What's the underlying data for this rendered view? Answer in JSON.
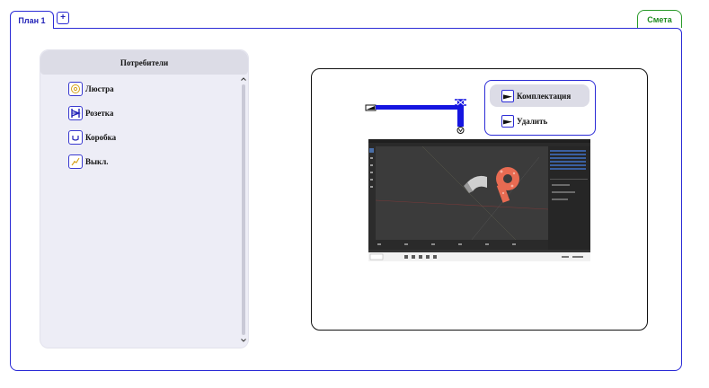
{
  "tabs": {
    "plan_label": "План 1",
    "add_label": "+",
    "estimate_label": "Смета"
  },
  "consumers": {
    "title": "Потребители",
    "items": [
      {
        "label": "Люстра",
        "icon": "chandelier-icon",
        "icon_color": "#d4a017"
      },
      {
        "label": "Розетка",
        "icon": "socket-icon",
        "icon_color": "#2323b8"
      },
      {
        "label": "Коробка",
        "icon": "junction-box-icon",
        "icon_color": "#2323b8"
      },
      {
        "label": "Выкл.",
        "icon": "switch-icon",
        "icon_color": "#d4a017"
      }
    ]
  },
  "context_menu": {
    "items": [
      {
        "label": "Комплектация",
        "icon": "wire-icon",
        "highlighted": true
      },
      {
        "label": "Удалить",
        "icon": "wire-icon",
        "highlighted": false
      }
    ]
  },
  "colors": {
    "accent": "#2b2bd6",
    "estimate_tab": "#1d8a1d",
    "panel_bg": "#ededf6",
    "wire": "#1515e0"
  }
}
